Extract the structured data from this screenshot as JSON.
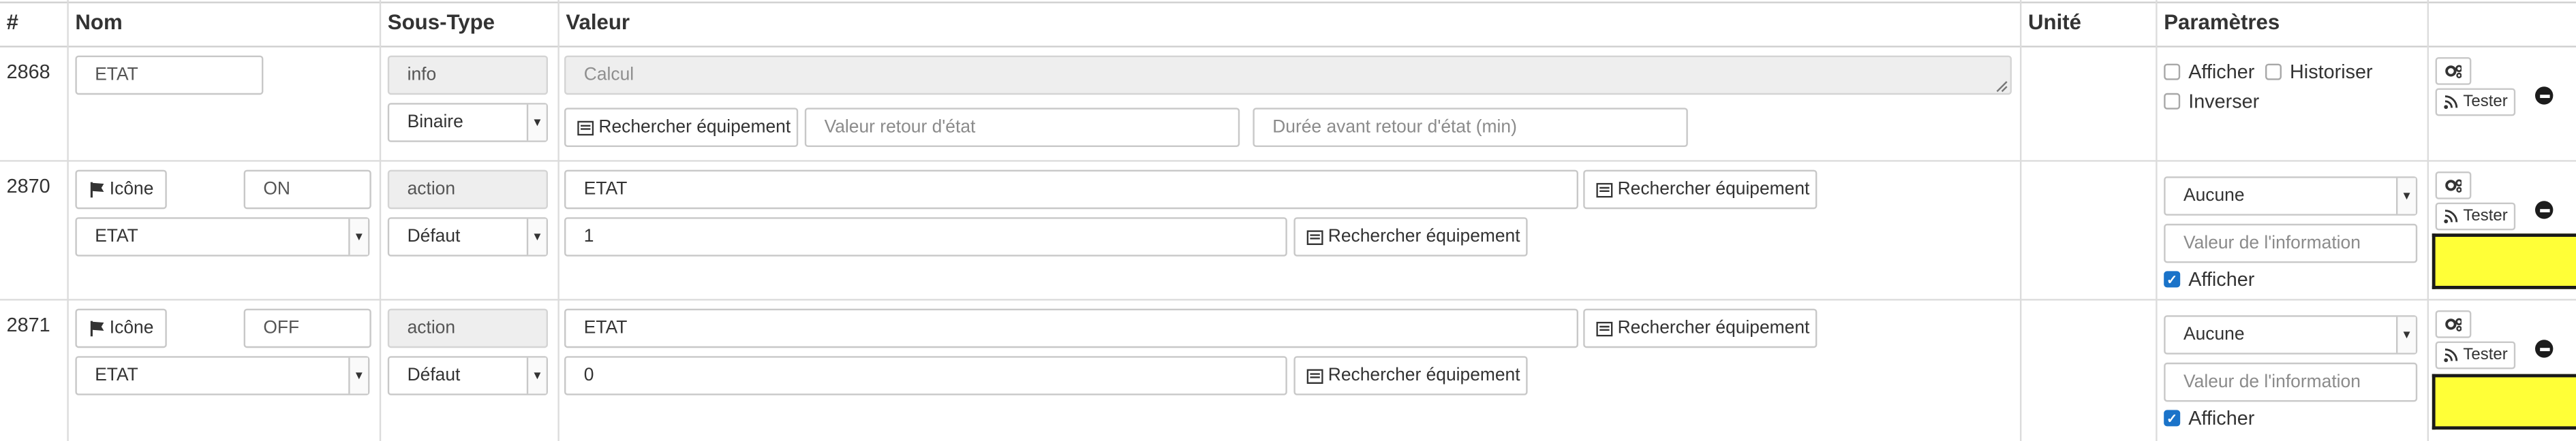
{
  "headers": {
    "num": "#",
    "nom": "Nom",
    "soustype": "Sous-Type",
    "valeur": "Valeur",
    "unite": "Unité",
    "parametres": "Paramètres"
  },
  "rows": [
    {
      "id": "2868",
      "name": "ETAT",
      "type_badge": "info",
      "subtype": "Binaire",
      "calc_placeholder": "Calcul",
      "search_label": "Rechercher équipement",
      "return_state_placeholder": "Valeur retour d'état",
      "return_delay_placeholder": "Durée avant retour d'état (min)",
      "afficher_label": "Afficher",
      "historiser_label": "Historiser",
      "inverser_label": "Inverser",
      "afficher_checked": false,
      "historiser_checked": false,
      "inverser_checked": false,
      "tester_label": "Tester"
    },
    {
      "id": "2870",
      "icon_label": "Icône",
      "name": "ON",
      "type_badge": "action",
      "linked_info": "ETAT",
      "subtype": "Défaut",
      "value_cmd": "ETAT",
      "value_num": "1",
      "search_label": "Rechercher équipement",
      "param_select": "Aucune",
      "info_value_placeholder": "Valeur de l'information",
      "afficher_label": "Afficher",
      "afficher_checked": true,
      "tester_label": "Tester",
      "swatch_color": "#ffff37"
    },
    {
      "id": "2871",
      "icon_label": "Icône",
      "name": "OFF",
      "type_badge": "action",
      "linked_info": "ETAT",
      "subtype": "Défaut",
      "value_cmd": "ETAT",
      "value_num": "0",
      "search_label": "Rechercher équipement",
      "param_select": "Aucune",
      "info_value_placeholder": "Valeur de l'information",
      "afficher_label": "Afficher",
      "afficher_checked": true,
      "tester_label": "Tester",
      "swatch_color": "#ffff37"
    }
  ],
  "icons": {
    "config": "gears-icon",
    "test": "rss-icon",
    "search": "list-alt-icon",
    "icon_picker": "flag-icon",
    "remove": "minus-circle-icon"
  }
}
